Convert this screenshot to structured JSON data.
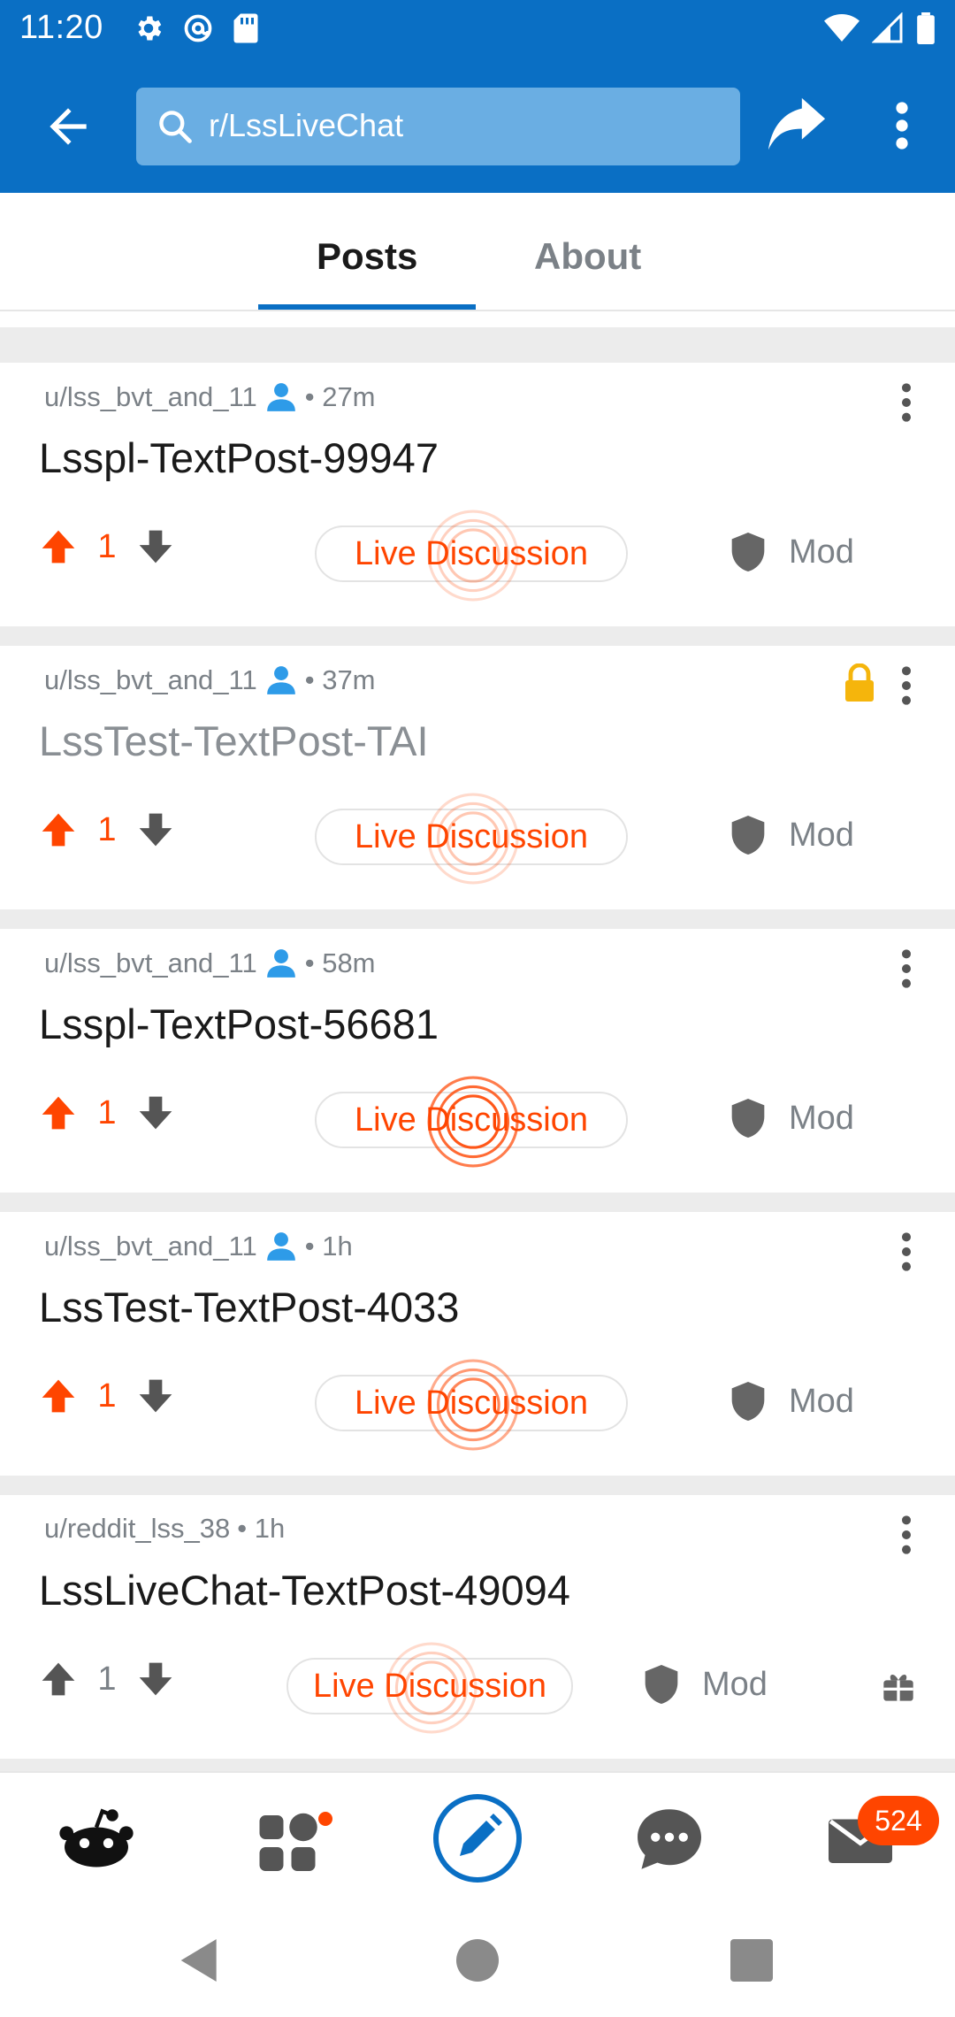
{
  "status_bar": {
    "time": "11:20"
  },
  "app_bar": {
    "search_text": "r/LssLiveChat"
  },
  "tabs": [
    {
      "label": "Posts",
      "selected": true
    },
    {
      "label": "About",
      "selected": false
    }
  ],
  "posts": [
    {
      "author": "u/lss_bvt_and_11",
      "age": "• 27m",
      "title": "Lsspl-TextPost-99947",
      "votes": "1",
      "upvoted": true,
      "locked": false,
      "live_label": "Live Discussion",
      "mod_label": "Mod"
    },
    {
      "author": "u/lss_bvt_and_11",
      "age": "• 37m",
      "title": "LssTest-TextPost-TAI",
      "votes": "1",
      "upvoted": true,
      "locked": true,
      "live_label": "Live Discussion",
      "mod_label": "Mod"
    },
    {
      "author": "u/lss_bvt_and_11",
      "age": "• 58m",
      "title": "Lsspl-TextPost-56681",
      "votes": "1",
      "upvoted": true,
      "locked": false,
      "live_label": "Live Discussion",
      "mod_label": "Mod"
    },
    {
      "author": "u/lss_bvt_and_11",
      "age": "• 1h",
      "title": "LssTest-TextPost-4033",
      "votes": "1",
      "upvoted": true,
      "locked": false,
      "live_label": "Live Discussion",
      "mod_label": "Mod"
    },
    {
      "author": "u/reddit_lss_38",
      "age": "• 1h",
      "title": "LssLiveChat-TextPost-49094",
      "votes": "1",
      "upvoted": false,
      "locked": false,
      "live_label": "Live Discussion",
      "mod_label": "Mod"
    }
  ],
  "bottom_nav": {
    "inbox_badge": "524"
  },
  "colors": {
    "brand_blue": "#0a6fc4",
    "accent_orange": "#ff4500",
    "muted_gray": "#7b8187"
  },
  "icons": [
    "back-arrow-icon",
    "search-icon",
    "share-icon",
    "more-vert-icon",
    "user-icon",
    "lock-icon",
    "upvote-icon",
    "downvote-icon",
    "shield-icon",
    "gift-icon",
    "home-icon",
    "communities-icon",
    "create-post-icon",
    "chat-icon",
    "inbox-icon"
  ]
}
